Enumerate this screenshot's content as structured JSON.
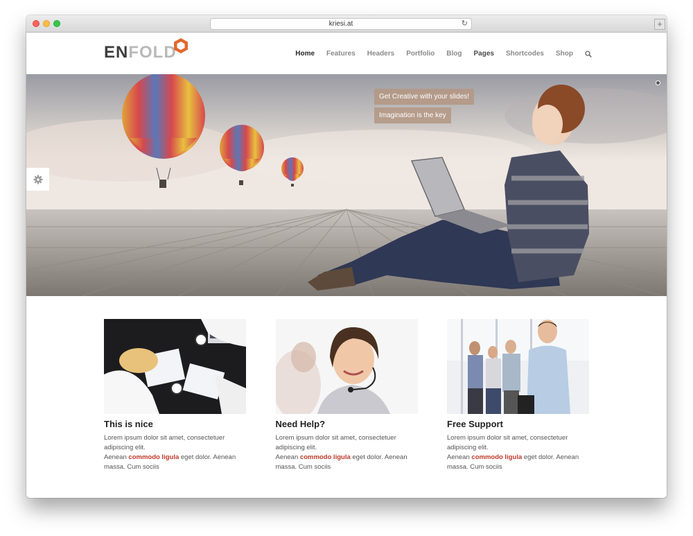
{
  "browser": {
    "url": "kriesi.at"
  },
  "logo": {
    "part1": "EN",
    "part2": "FOLD"
  },
  "nav": {
    "items": [
      "Home",
      "Features",
      "Headers",
      "Portfolio",
      "Blog",
      "Pages",
      "Shortcodes",
      "Shop"
    ],
    "active": "Home"
  },
  "slider": {
    "caption1": "Get Creative with your slides!",
    "caption2": "Imagination is the key"
  },
  "features": [
    {
      "title": "This is nice",
      "line1": "Lorem ipsum dolor sit amet, consectetuer adipiscing elit.",
      "pre": "Aenean ",
      "highlight": "commodo ligula",
      "post": " eget dolor. Aenean massa. Cum sociis"
    },
    {
      "title": "Need Help?",
      "line1": "Lorem ipsum dolor sit amet, consectetuer adipiscing elit.",
      "pre": "Aenean ",
      "highlight": "commodo ligula",
      "post": " eget dolor. Aenean massa. Cum sociis"
    },
    {
      "title": "Free Support",
      "line1": "Lorem ipsum dolor sit amet, consectetuer adipiscing elit.",
      "pre": "Aenean ",
      "highlight": "commodo ligula",
      "post": " eget dolor. Aenean massa. Cum sociis"
    }
  ],
  "colors": {
    "accent": "#c0392b",
    "logo_hex": "#e2672e",
    "caption_bg": "#b49682"
  }
}
